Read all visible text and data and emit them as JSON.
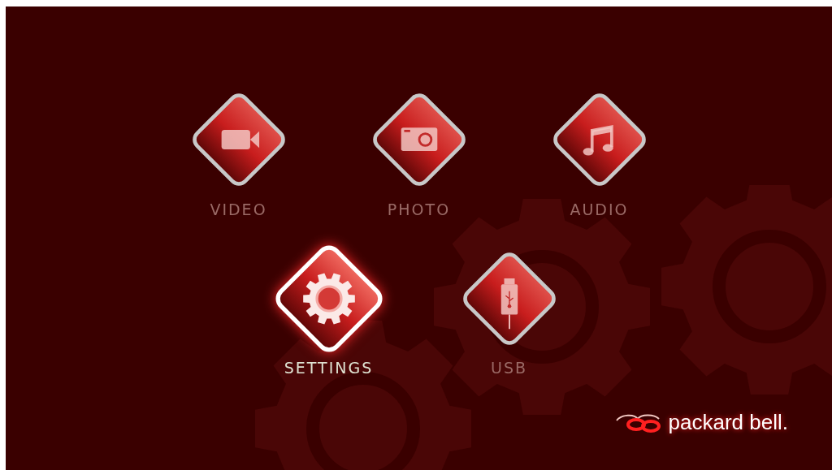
{
  "menu": {
    "rows": [
      {
        "items": [
          {
            "kind": "video",
            "label": "VIDEO",
            "selected": false
          },
          {
            "kind": "photo",
            "label": "PHOTO",
            "selected": false
          },
          {
            "kind": "audio",
            "label": "AUDIO",
            "selected": false
          }
        ]
      },
      {
        "items": [
          {
            "kind": "settings",
            "label": "SETTINGS",
            "selected": true
          },
          {
            "kind": "usb",
            "label": "USB",
            "selected": false
          }
        ]
      }
    ]
  },
  "brand": {
    "name": "packard bell."
  }
}
